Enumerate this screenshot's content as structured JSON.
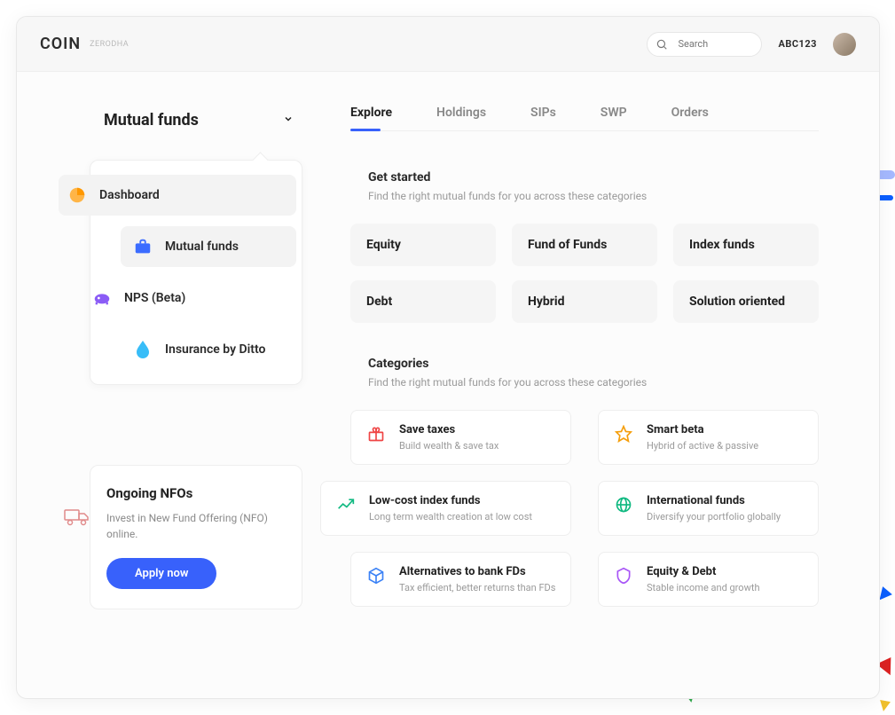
{
  "header": {
    "logo": "COIN",
    "logo_sub": "ZERODHA",
    "search_placeholder": "Search",
    "client_id": "ABC123"
  },
  "sidebar": {
    "dropdown_label": "Mutual funds",
    "nav": {
      "dashboard": "Dashboard",
      "mutual_funds": "Mutual funds",
      "nps": "NPS (Beta)",
      "insurance": "Insurance by Ditto"
    },
    "nfo": {
      "title": "Ongoing NFOs",
      "desc": "Invest in New Fund Offering (NFO) online.",
      "button": "Apply now"
    }
  },
  "tabs": [
    "Explore",
    "Holdings",
    "SIPs",
    "SWP",
    "Orders"
  ],
  "get_started": {
    "title": "Get started",
    "subtitle": "Find the right mutual funds for you across these categories",
    "chips": [
      "Equity",
      "Fund of Funds",
      "Index funds",
      "Debt",
      "Hybrid",
      "Solution oriented"
    ]
  },
  "categories": {
    "title": "Categories",
    "subtitle": "Find the right mutual funds for you across these categories",
    "cards": [
      {
        "title": "Save taxes",
        "desc": "Build wealth & save tax"
      },
      {
        "title": "Smart beta",
        "desc": "Hybrid of active & passive"
      },
      {
        "title": "Low-cost index funds",
        "desc": "Long term wealth creation at low cost"
      },
      {
        "title": "International funds",
        "desc": "Diversify your portfolio globally"
      },
      {
        "title": "Alternatives to bank FDs",
        "desc": "Tax efficient, better returns than FDs"
      },
      {
        "title": "Equity & Debt",
        "desc": "Stable income and growth"
      }
    ]
  }
}
